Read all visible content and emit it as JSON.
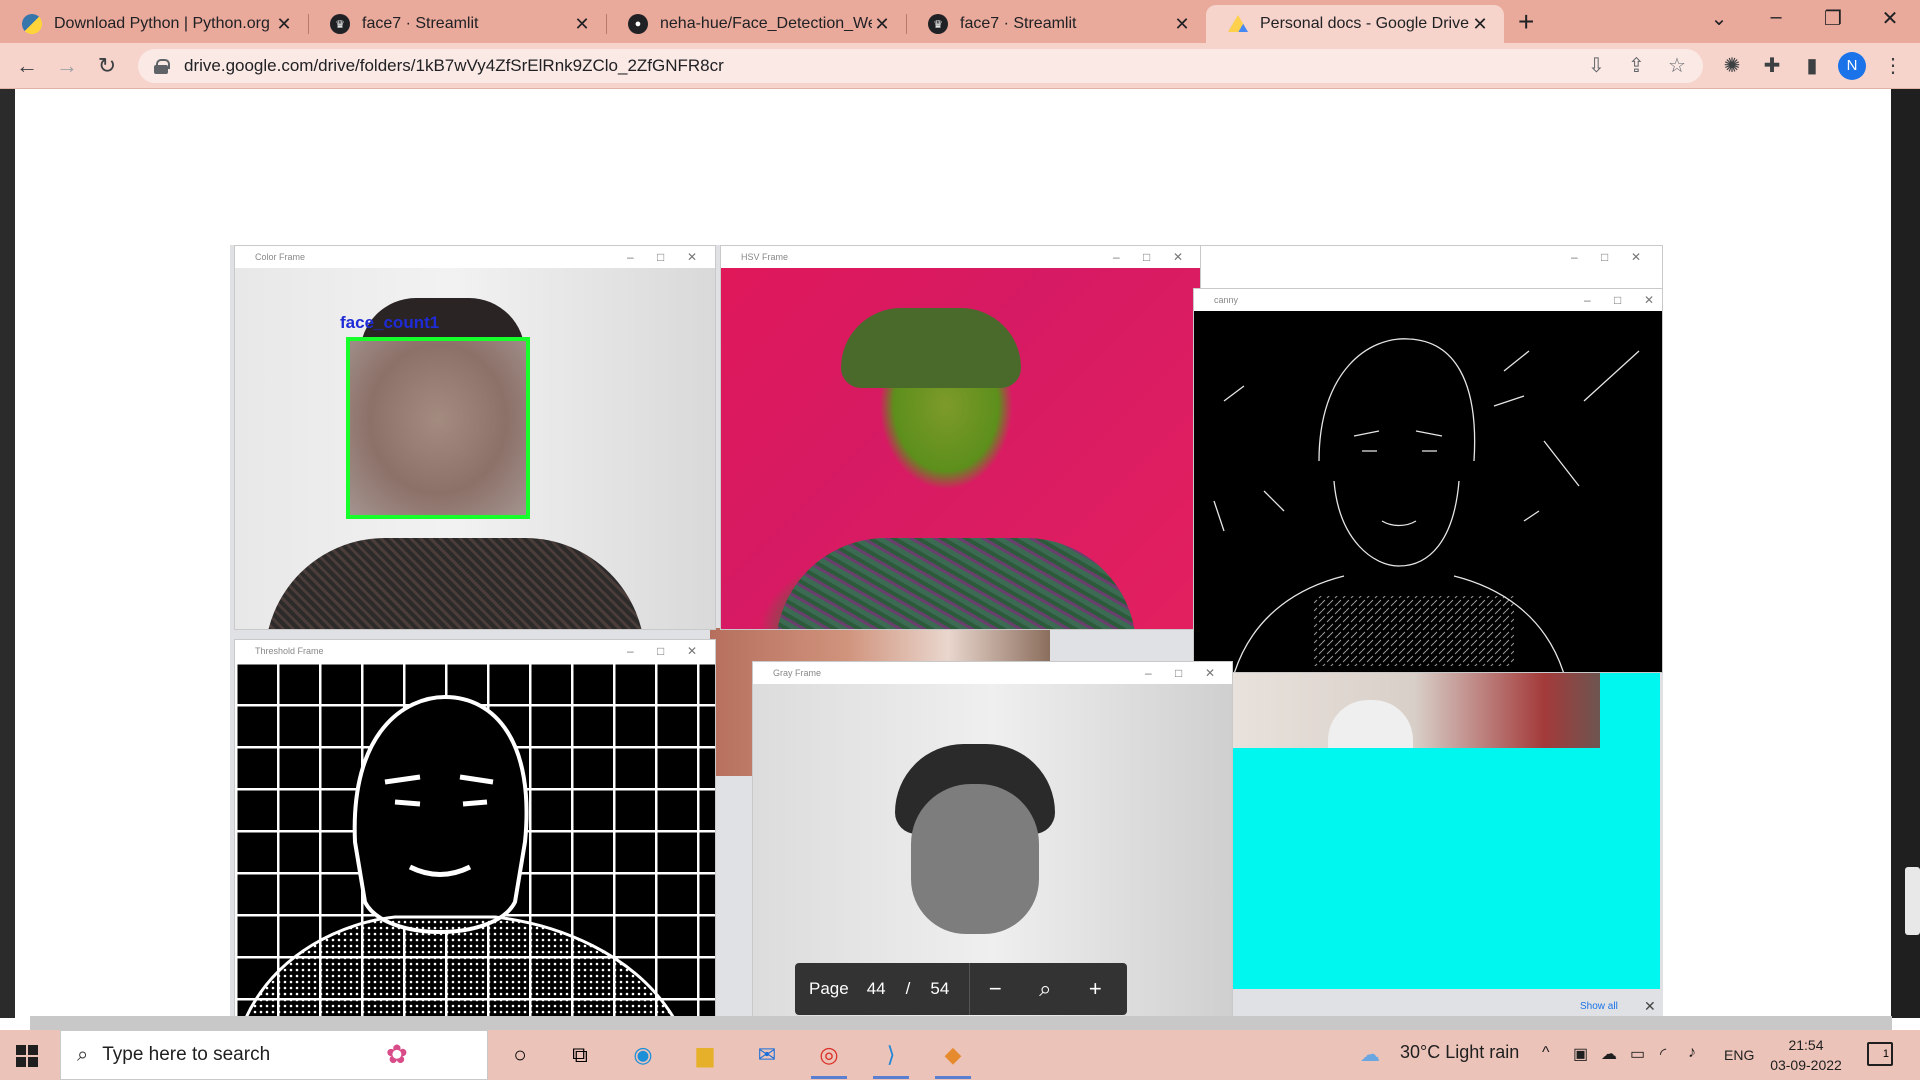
{
  "browser": {
    "tabs": [
      {
        "title": "Download Python | Python.org",
        "icon": "python-icon",
        "active": false
      },
      {
        "title": "face7 · Streamlit",
        "icon": "streamlit-icon",
        "active": false
      },
      {
        "title": "neha-hue/Face_Detection_WebA",
        "icon": "github-icon",
        "active": false
      },
      {
        "title": "face7 · Streamlit",
        "icon": "streamlit-icon",
        "active": false
      },
      {
        "title": "Personal docs - Google Drive",
        "icon": "google-drive-icon",
        "active": true
      }
    ],
    "url": "drive.google.com/drive/folders/1kB7wVy4ZfSrElRnk9ZClo_2ZfGNFR8cr",
    "profile_initial": "N"
  },
  "document": {
    "windows": {
      "color_frame": "Color Frame",
      "hsv_frame": "HSV Frame",
      "canny": "canny",
      "threshold_frame": "Threshold Frame",
      "gray_frame": "Gray Frame"
    },
    "face_label": "face_count1",
    "show_all": "Show all"
  },
  "page_control": {
    "label": "Page",
    "current": "44",
    "separator": "/",
    "total": "54"
  },
  "taskbar": {
    "search_placeholder": "Type here to search",
    "weather": "30°C  Light rain",
    "language": "ENG",
    "time": "21:54",
    "date": "03-09-2022",
    "notification_count": "1"
  },
  "colors": {
    "tab_bar": "#e9a99b",
    "toolbar": "#f6d3cb",
    "face_box": "#17ff2a",
    "face_label": "#1f2bd6",
    "cyan": "#00f7f0"
  }
}
